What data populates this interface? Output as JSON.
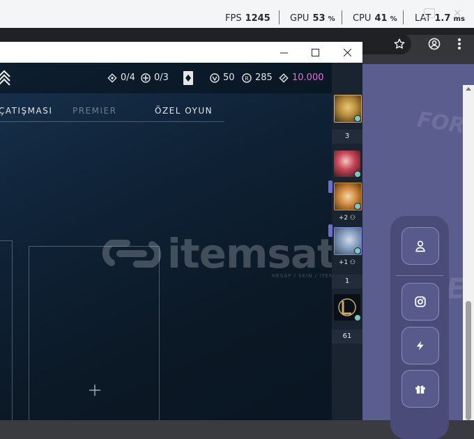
{
  "overlay": {
    "fps_label": "FPS",
    "fps_value": "1245",
    "gpu_label": "GPU",
    "gpu_value": "53",
    "gpu_unit": "%",
    "cpu_label": "CPU",
    "cpu_value": "41",
    "cpu_unit": "%",
    "lat_label": "LAT",
    "lat_value": "1.7",
    "lat_unit": "ms"
  },
  "game": {
    "currency": {
      "missions": "0/4",
      "contracts": "0/3",
      "vp": "50",
      "radianite": "285",
      "kingdom": "10.000"
    },
    "tabs": [
      "ÇATIŞMASI",
      "PREMIER",
      "ÖZEL OYUN"
    ],
    "watermark": "itemsat",
    "watermark_sub": "HESAP / SKIN / ITEM"
  },
  "friends": {
    "counts": [
      "3",
      "1",
      "61"
    ],
    "groups": [
      "+2",
      "+1"
    ]
  },
  "colors": {
    "accent_pink": "#e56fd6",
    "status_online": "#7ec7c0",
    "page_purple": "#5b5d8e"
  },
  "icons": [
    "star-icon",
    "profile-icon",
    "kebab-menu-icon",
    "settings-icon",
    "user-icon",
    "instagram-icon",
    "lightning-icon",
    "gift-icon"
  ]
}
